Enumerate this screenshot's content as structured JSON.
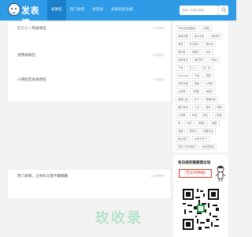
{
  "logo": {
    "text": "发表情"
  },
  "nav": [
    {
      "label": "表情包",
      "active": true
    },
    {
      "label": "热门表情",
      "active": false
    },
    {
      "label": "标签墙",
      "active": false
    },
    {
      "label": "表情包后台端",
      "active": false
    }
  ],
  "search": {
    "placeholder": "请输入关键词搜索",
    "icon": "search-icon"
  },
  "cards": [
    {
      "title": "打工人一周表情包",
      "count": "77张表情"
    },
    {
      "title": "宠物表情包",
      "count": "97张表情"
    },
    {
      "title": "小黄脸无语表情包",
      "count": "77张表情"
    },
    {
      "title": "热门表情，让你的斗图不翻翻翻",
      "count": "167张表情"
    }
  ],
  "tags": [
    "不说话也很尴尬",
    "小黄脸",
    "搞怪动物",
    "我又没有",
    "可爱的牛",
    "看看",
    "吃瓜群众",
    "表情包",
    "我好看",
    "熊猫头",
    "亲亲",
    "感谢有你",
    "被打懵了",
    "不想人",
    "下载",
    "打工人",
    "哈一哈",
    "sad frog",
    "青蛙",
    "嘴甜",
    "童童可爱",
    "猫咪",
    "小黄鸭",
    "小黄鸭",
    "下班啦",
    "熊猫头",
    "我要上班",
    "生气",
    "喂我吃饭",
    "撒打游戏",
    "工友",
    "表情",
    "嗯嗯",
    "小黄鸭",
    "好猫",
    "撑住",
    "小黄脸",
    "乖",
    "你好",
    "熊猫头",
    "刷屏",
    "熊猫",
    "表情包",
    "我要说话",
    "我太难了",
    "大事不好了",
    "吃饭了没有表情",
    "没有表情包"
  ],
  "ad": {
    "title": "有白底的图都是垃圾",
    "box_text": "[无论何种题]",
    "figure_icon": "cartoon-figure-icon",
    "qr_icon": "qr-code-icon"
  },
  "watermark": "玫收录",
  "colors": {
    "header": "#2e9be6",
    "nav_active": "#1b7fcc",
    "ad_accent": "#d63a2a",
    "watermark": "#b7e2ca"
  }
}
